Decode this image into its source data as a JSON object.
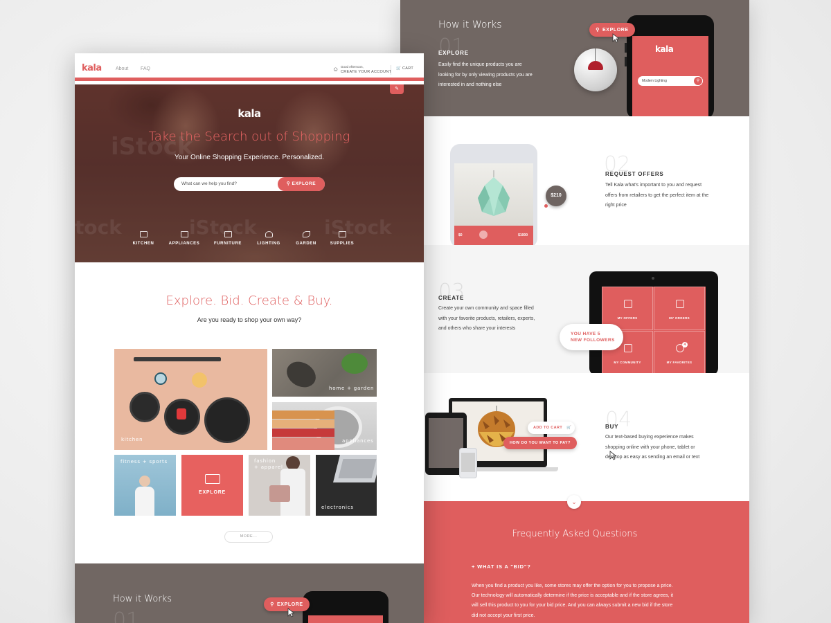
{
  "colors": {
    "brand": "#df5e5e",
    "dark_band": "#716763"
  },
  "left": {
    "nav": {
      "logo": "kala",
      "links": [
        "About",
        "FAQ"
      ],
      "greeting": "Good Afternoon,",
      "account": "CREATE YOUR ACCOUNT",
      "cart": "CART"
    },
    "hero": {
      "logo": "kala",
      "title": "Take the Search out of Shopping",
      "subtitle": "Your Online Shopping Experience. Personalized.",
      "search_placeholder": "What can we help you find?",
      "search_button": "EXPLORE",
      "categories": [
        "KITCHEN",
        "APPLIANCES",
        "FURNITURE",
        "LIGHTING",
        "GARDEN",
        "SUPPLIES"
      ]
    },
    "explore": {
      "title": "Explore. Bid. Create & Buy.",
      "subtitle": "Are you ready to shop your own way?"
    },
    "tiles": {
      "kitchen": "kitchen",
      "garden": "home + garden",
      "appliances": "appliances",
      "fitness": "fitness + sports",
      "explore": "EXPLORE",
      "fashion_1": "fashion",
      "fashion_2": "+ apparel",
      "electronics": "electronics"
    },
    "more": "MORE...",
    "how_title": "How it Works",
    "how_num": "01",
    "how_button": "EXPLORE"
  },
  "right": {
    "how_title": "How it Works",
    "steps": [
      {
        "num": "01",
        "title": "EXPLORE",
        "desc": [
          "Easily find the unique products you are",
          "looking for by only viewing products you are",
          "interested in and nothing else"
        ]
      },
      {
        "num": "02",
        "title": "REQUEST OFFERS",
        "desc": [
          "Tell Kala what's important to you and request",
          "offers from retailers to get the perfect item at the",
          "right price"
        ]
      },
      {
        "num": "03",
        "title": "CREATE",
        "desc": [
          "Create your own community and space filled",
          "with your favorite products, retailers, experts,",
          "and others who share your interests"
        ]
      },
      {
        "num": "04",
        "title": "BUY",
        "desc": [
          "Our text-based buying experience makes",
          "shopping online with your phone, tablet or",
          "desktop as easy as sending an email or text"
        ]
      }
    ],
    "explore_button": "EXPLORE",
    "phone_logo": "kala",
    "phone_search": "Modern Lighting",
    "price_bubble": "$210",
    "slider_min": "$0",
    "slider_max": "$1000",
    "tablet_cells": [
      "MY OFFERS",
      "MY ORDERS",
      "MY COMMUNITY",
      "MY FAVORITES"
    ],
    "favorites_count": "4",
    "followers_line1": "YOU HAVE 5",
    "followers_line2": "NEW FOLLOWERS",
    "add_to_cart": "ADD TO CART",
    "how_pay": "HOW DO YOU WANT TO PAY?",
    "faq": {
      "title": "Frequently Asked Questions",
      "question": "+ WHAT IS A \"BID\"?",
      "answer": "When you find a product you like, some stores may offer the option for you to propose a price. Our technology will automatically determine if the price is acceptable and if the store agrees, it will sell this product to you for your bid price. And you can always submit a new bid if the store did not accept your first price."
    }
  }
}
